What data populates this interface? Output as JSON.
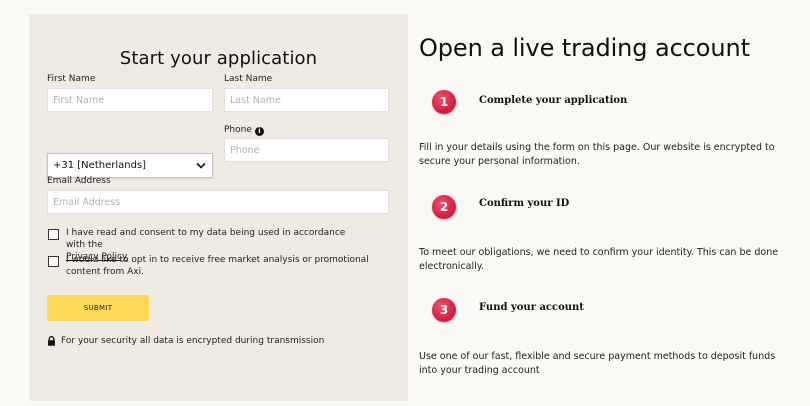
{
  "form": {
    "title": "Start your application",
    "first_name_label": "First Name",
    "first_name_placeholder": "First Name",
    "last_name_label": "Last Name",
    "last_name_placeholder": "Last Name",
    "country_code_value": "+31 [Netherlands]",
    "phone_label": "Phone",
    "phone_placeholder": "Phone",
    "email_label": "Email Address",
    "email_placeholder": "Email Address",
    "consent_text": "I have read and consent to my data being used in accordance with the",
    "privacy_link": "Privacy Policy",
    "optin_text": "I would like to opt in to receive free market analysis or promotional content from Axi.",
    "submit_label": "SUBMIT",
    "security_note": "For your security all data is encrypted during transmission"
  },
  "info": {
    "title": "Open a live trading account",
    "steps": [
      {
        "number": "1",
        "title": "Complete your application",
        "description": "Fill in your details using the form on this page. Our website is encrypted to secure your personal information."
      },
      {
        "number": "2",
        "title": "Confirm your ID",
        "description": "To meet our obligations, we need to confirm your identity. This can be done electronically."
      },
      {
        "number": "3",
        "title": "Fund your account",
        "description": "Use one of our fast, flexible and secure payment methods to deposit funds into your trading account"
      }
    ]
  },
  "colors": {
    "panel_bg": "#efebe3",
    "page_bg": "#fbf9f6",
    "submit_bg": "#fcd956",
    "step_badge": "#d8203f"
  },
  "icons": {
    "info": "info-icon",
    "lock": "lock-icon",
    "dropdown": "chevron-down-icon"
  }
}
